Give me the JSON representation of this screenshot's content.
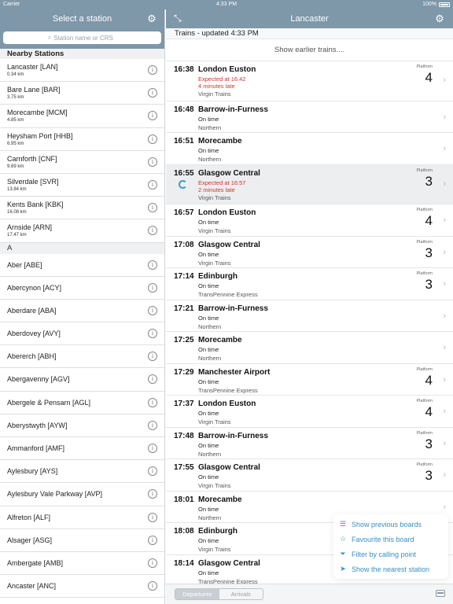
{
  "status_bar": {
    "carrier": "Carrier",
    "time": "4:33 PM",
    "battery": "100%"
  },
  "left": {
    "title": "Select a station",
    "search_placeholder": "Station name or CRS",
    "nearby_header": "Nearby Stations",
    "nearby": [
      {
        "name": "Lancaster [LAN]",
        "distance": "0.34 km"
      },
      {
        "name": "Bare Lane [BAR]",
        "distance": "3.75 km"
      },
      {
        "name": "Morecambe [MCM]",
        "distance": "4.85 km"
      },
      {
        "name": "Heysham Port [HHB]",
        "distance": "6.95 km"
      },
      {
        "name": "Carnforth [CNF]",
        "distance": "9.69 km"
      },
      {
        "name": "Silverdale [SVR]",
        "distance": "13.84 km"
      },
      {
        "name": "Kents Bank [KBK]",
        "distance": "16.08 km"
      },
      {
        "name": "Arnside [ARN]",
        "distance": "17.47 km"
      }
    ],
    "alpha_header": "A",
    "alpha": [
      "Aber [ABE]",
      "Abercynon [ACY]",
      "Aberdare [ABA]",
      "Aberdovey [AVY]",
      "Abererch [ABH]",
      "Abergavenny [AGV]",
      "Abergele & Pensarn [AGL]",
      "Aberystwyth [AYW]",
      "Ammanford [AMF]",
      "Aylesbury [AYS]",
      "Aylesbury Vale Parkway [AVP]",
      "Alfreton [ALF]",
      "Alsager [ASG]",
      "Ambergate [AMB]",
      "Ancaster [ANC]"
    ]
  },
  "right": {
    "title": "Lancaster",
    "updated": "Trains - updated 4:33 PM",
    "earlier": "Show earlier trains....",
    "platform_label": "Platform",
    "trains": [
      {
        "time": "16:38",
        "dest": "London Euston",
        "status": "Expected at 16:42",
        "late": "4 minutes late",
        "operator": "Virgin Trains",
        "platform": "4"
      },
      {
        "time": "16:48",
        "dest": "Barrow-in-Furness",
        "status": "On time",
        "late": "",
        "operator": "Northern",
        "platform": ""
      },
      {
        "time": "16:51",
        "dest": "Morecambe",
        "status": "On time",
        "late": "",
        "operator": "Northern",
        "platform": ""
      },
      {
        "time": "16:55",
        "dest": "Glasgow Central",
        "status": "Expected at 16:57",
        "late": "2 minutes late",
        "operator": "Virgin Trains",
        "platform": "3"
      },
      {
        "time": "16:57",
        "dest": "London Euston",
        "status": "On time",
        "late": "",
        "operator": "Virgin Trains",
        "platform": "4"
      },
      {
        "time": "17:08",
        "dest": "Glasgow Central",
        "status": "On time",
        "late": "",
        "operator": "Virgin Trains",
        "platform": "3"
      },
      {
        "time": "17:14",
        "dest": "Edinburgh",
        "status": "On time",
        "late": "",
        "operator": "TransPennine Express",
        "platform": "3"
      },
      {
        "time": "17:21",
        "dest": "Barrow-in-Furness",
        "status": "On time",
        "late": "",
        "operator": "Northern",
        "platform": ""
      },
      {
        "time": "17:25",
        "dest": "Morecambe",
        "status": "On time",
        "late": "",
        "operator": "Northern",
        "platform": ""
      },
      {
        "time": "17:29",
        "dest": "Manchester Airport",
        "status": "On time",
        "late": "",
        "operator": "TransPennine Express",
        "platform": "4"
      },
      {
        "time": "17:37",
        "dest": "London Euston",
        "status": "On time",
        "late": "",
        "operator": "Virgin Trains",
        "platform": "4"
      },
      {
        "time": "17:48",
        "dest": "Barrow-in-Furness",
        "status": "On time",
        "late": "",
        "operator": "Northern",
        "platform": "3"
      },
      {
        "time": "17:55",
        "dest": "Glasgow Central",
        "status": "On time",
        "late": "",
        "operator": "Virgin Trains",
        "platform": "3"
      },
      {
        "time": "18:01",
        "dest": "Morecambe",
        "status": "On time",
        "late": "",
        "operator": "Northern",
        "platform": ""
      },
      {
        "time": "18:08",
        "dest": "Edinburgh",
        "status": "On time",
        "late": "",
        "operator": "Virgin Trains",
        "platform": ""
      },
      {
        "time": "18:14",
        "dest": "Glasgow Central",
        "status": "On time",
        "late": "",
        "operator": "TransPennine Express",
        "platform": ""
      }
    ],
    "menu": [
      {
        "label": "Show previous boards",
        "icon": "list-icon"
      },
      {
        "label": "Favourite this board",
        "icon": "star-icon"
      },
      {
        "label": "Filter by calling point",
        "icon": "filter-icon"
      },
      {
        "label": "Show the nearest station",
        "icon": "location-arrow-icon"
      }
    ],
    "segment": {
      "departures": "Departures",
      "arrivals": "Arrivals"
    }
  },
  "colors": {
    "nav_bar": "#7e97a9",
    "late_red": "#d0342c",
    "menu_blue": "#3a8fc1"
  }
}
